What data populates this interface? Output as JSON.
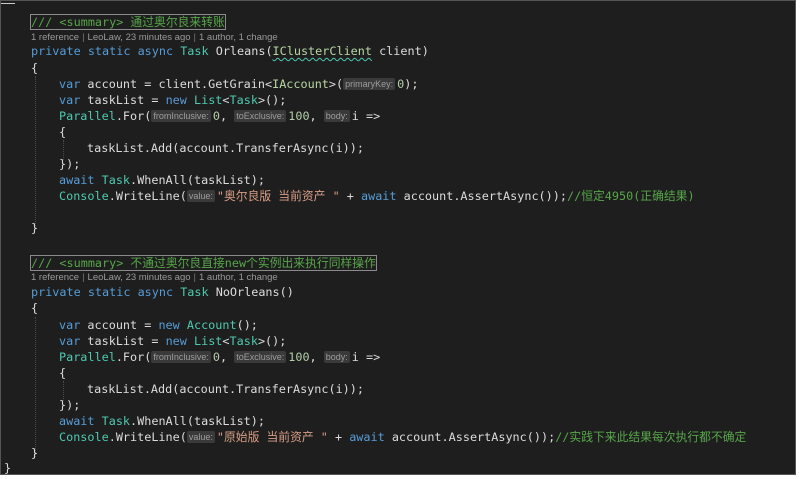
{
  "method1": {
    "summary": "/// <summary> 通过奥尔良来转账",
    "lens": {
      "references": "1 reference",
      "author_time": "LeoLaw, 23 minutes ago",
      "changes": "1 author, 1 change"
    },
    "signature": {
      "private": "private",
      "static": "static",
      "async": "async",
      "task": "Task",
      "name": "Orleans",
      "param_type": "IClusterClient",
      "param_name": "client"
    },
    "open_brace": "{",
    "close_brace": "}",
    "line_account": {
      "var": "var",
      "lhs": "account = client.GetGrain<",
      "iface": "IAccount",
      "mid": ">(",
      "hint": "primaryKey:",
      "value": "0",
      "end": ");"
    },
    "line_tasklist": {
      "var": "var",
      "lhs": "taskList = ",
      "new": "new",
      "list": "List",
      "lt": "<",
      "task": "Task",
      "end": ">();"
    },
    "line_parallel": {
      "parallel": "Parallel",
      "for": ".For(",
      "hint1": "fromInclusive:",
      "v1": "0",
      "comma1": ", ",
      "hint2": "toExclusive:",
      "v2": "100",
      "comma2": ", ",
      "hint3": "body:",
      "tail": "i =>"
    },
    "lambda_open": "{",
    "line_add": "taskList.Add(account.TransferAsync(i));",
    "lambda_close": "});",
    "line_whenall": {
      "await": "await",
      "task": "Task",
      "rest": ".WhenAll(taskList);"
    },
    "line_write": {
      "console": "Console",
      "write": ".WriteLine(",
      "hint": "value:",
      "str": "\"奥尔良版 当前资产 \"",
      "plus": " + ",
      "await": "await",
      "call": " account.AssertAsync());",
      "comment": "//恒定4950(正确结果)"
    }
  },
  "method2": {
    "summary": "/// <summary> 不通过奥尔良直接new个实例出来执行同样操作",
    "lens": {
      "references": "1 reference",
      "author_time": "LeoLaw, 23 minutes ago",
      "changes": "1 author, 1 change"
    },
    "signature": {
      "private": "private",
      "static": "static",
      "async": "async",
      "task": "Task",
      "name": "NoOrleans()"
    },
    "open_brace": "{",
    "close_brace": "}",
    "line_account": {
      "var": "var",
      "lhs": "account = ",
      "new": "new",
      "type": "Account",
      "end": "();"
    },
    "line_tasklist": {
      "var": "var",
      "lhs": "taskList = ",
      "new": "new",
      "list": "List",
      "lt": "<",
      "task": "Task",
      "end": ">();"
    },
    "line_parallel": {
      "parallel": "Parallel",
      "for": ".For(",
      "hint1": "fromInclusive:",
      "v1": "0",
      "comma1": ", ",
      "hint2": "toExclusive:",
      "v2": "100",
      "comma2": ", ",
      "hint3": "body:",
      "tail": "i =>"
    },
    "lambda_open": "{",
    "line_add": "taskList.Add(account.TransferAsync(i));",
    "lambda_close": "});",
    "line_whenall": {
      "await": "await",
      "task": "Task",
      "rest": ".WhenAll(taskList);"
    },
    "line_write": {
      "console": "Console",
      "write": ".WriteLine(",
      "hint": "value:",
      "str": "\"原始版 当前资产 \"",
      "plus": " + ",
      "await": "await",
      "call": " account.AssertAsync());",
      "comment": "//实践下来此结果每次执行都不确定"
    }
  },
  "class_close": "}",
  "colors": {
    "background": "#1e1e1e",
    "keyword": "#569cd6",
    "type": "#4ec9b0",
    "comment": "#57a64a",
    "string": "#d69d85",
    "number": "#b5cea8",
    "interface": "#b8d7a3"
  }
}
